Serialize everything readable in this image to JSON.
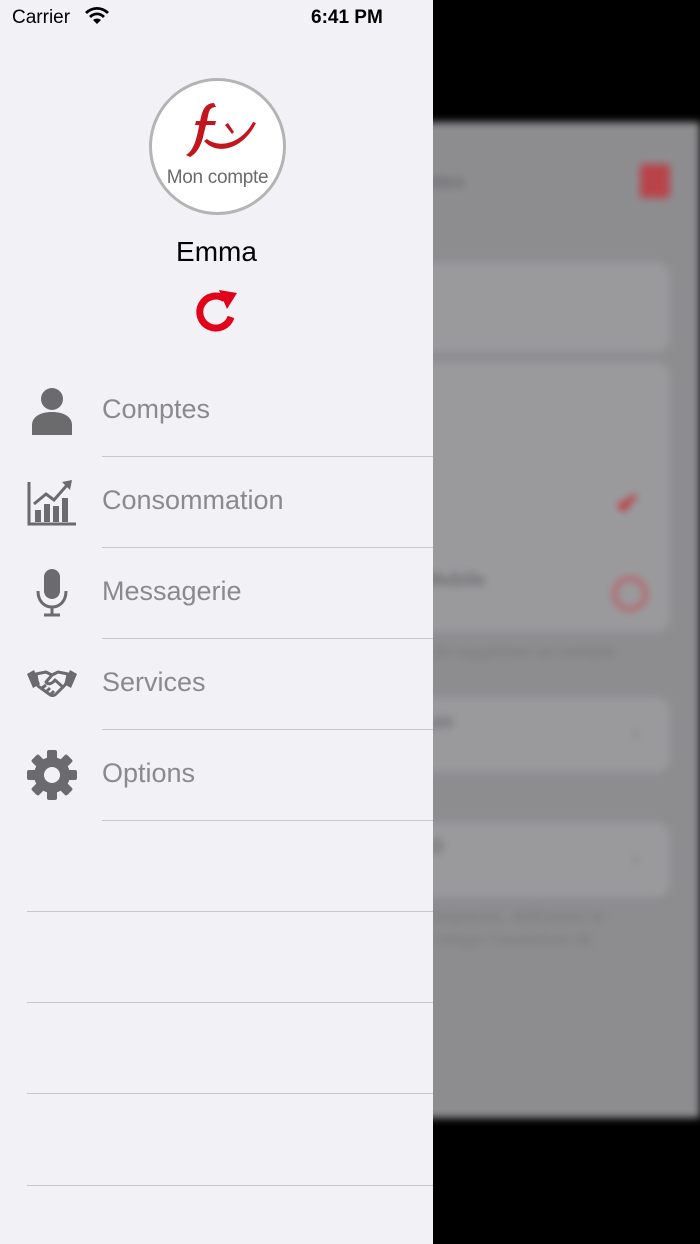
{
  "status_bar": {
    "carrier": "Carrier",
    "time": "6:41 PM"
  },
  "profile": {
    "logo_text": "Mon compte",
    "name": "Emma"
  },
  "menu": [
    {
      "label": "Comptes",
      "icon": "person-icon"
    },
    {
      "label": "Consommation",
      "icon": "chart-icon"
    },
    {
      "label": "Messagerie",
      "icon": "microphone-icon"
    },
    {
      "label": "Services",
      "icon": "handshake-icon"
    },
    {
      "label": "Options",
      "icon": "gear-icon"
    }
  ],
  "colors": {
    "accent": "#e2001a",
    "icon": "#6b6b6d",
    "drawer_bg": "#f2f1f6"
  }
}
